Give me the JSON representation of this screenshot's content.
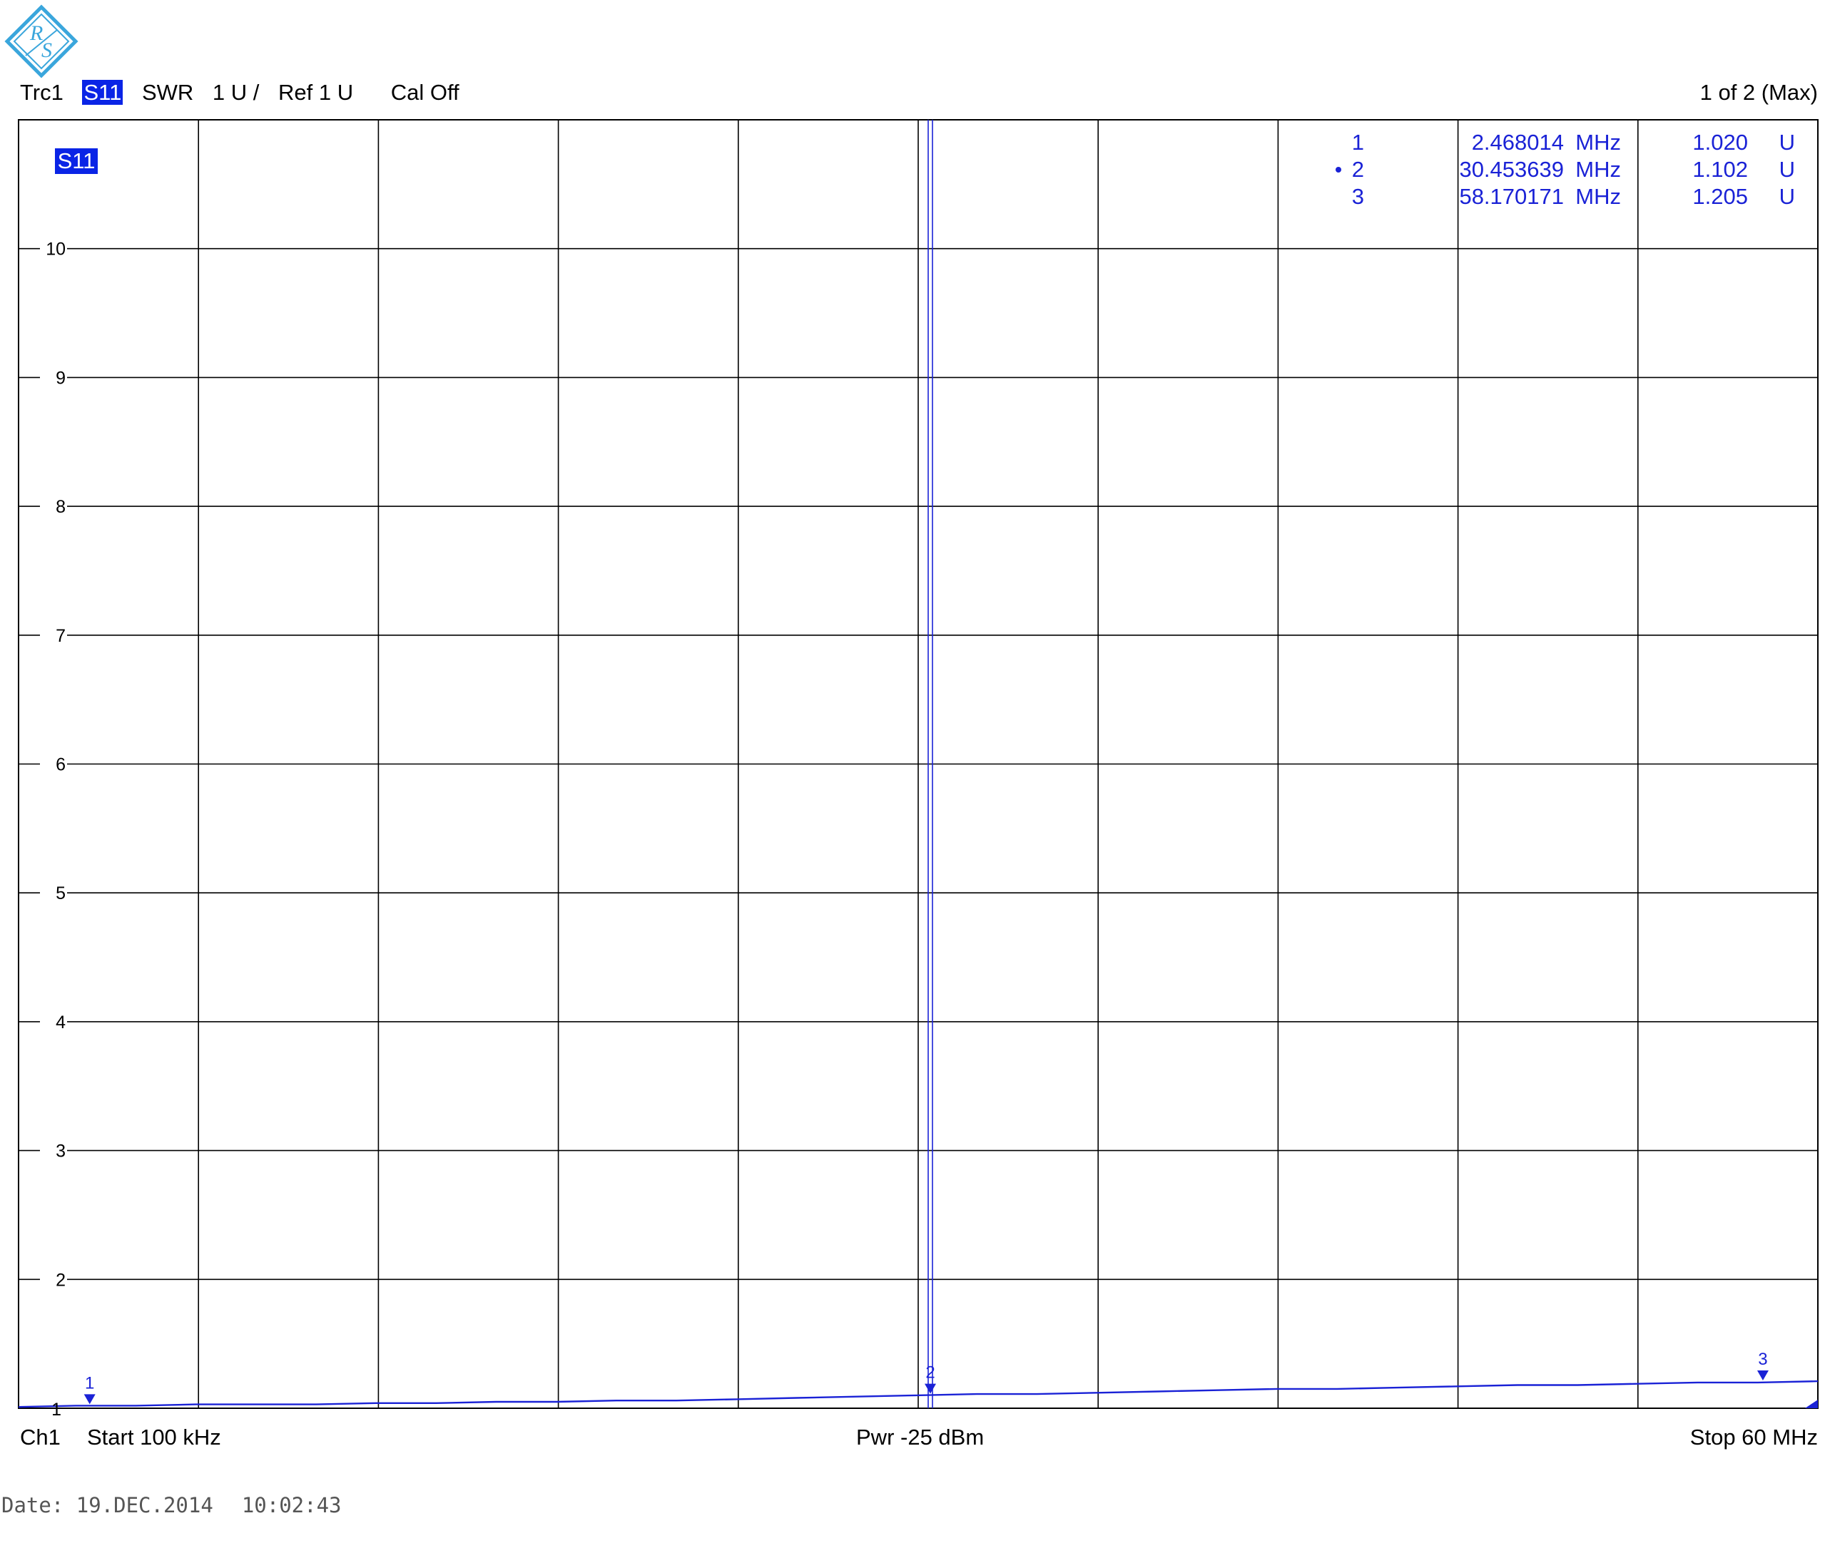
{
  "header": {
    "trace": "Trc1",
    "parameter": "S11",
    "format": "SWR",
    "scale": "1 U /",
    "ref": "Ref 1 U",
    "cal": "Cal Off",
    "page_indicator": "1 of 2 (Max)"
  },
  "trace_badge": "S11",
  "logo_name": "rohde-schwarz-logo",
  "colors": {
    "trace": "#1a22d6",
    "badge_bg": "#0a24e6",
    "logo": "#3aa6dc",
    "grid": "#000000"
  },
  "chart_data": {
    "type": "line",
    "xlabel": "",
    "ylabel": "",
    "xlim": [
      0.1,
      60
    ],
    "ylim": [
      1,
      11
    ],
    "yticks": [
      2,
      3,
      4,
      5,
      6,
      7,
      8,
      9,
      10
    ],
    "ytick_labels": [
      "2",
      "3",
      "4",
      "5",
      "6",
      "7",
      "8",
      "9",
      "10"
    ],
    "bottom_label": "1",
    "grid": true,
    "x_divisions": 10,
    "series": [
      {
        "x": [
          0.1,
          2,
          4,
          6,
          8,
          10,
          12,
          14,
          16,
          18,
          20,
          22,
          24,
          26,
          28,
          30,
          32,
          34,
          36,
          38,
          40,
          42,
          44,
          46,
          48,
          50,
          52,
          54,
          56,
          58,
          60
        ],
        "y": [
          1.01,
          1.02,
          1.02,
          1.03,
          1.03,
          1.03,
          1.04,
          1.04,
          1.05,
          1.05,
          1.06,
          1.06,
          1.07,
          1.08,
          1.09,
          1.1,
          1.11,
          1.11,
          1.12,
          1.13,
          1.14,
          1.15,
          1.15,
          1.16,
          1.17,
          1.18,
          1.18,
          1.19,
          1.2,
          1.2,
          1.21
        ]
      }
    ],
    "markers": [
      {
        "id": "1",
        "freq": "2.468014",
        "freq_unit": "MHz",
        "value": "1.020",
        "value_unit": "U",
        "x": 2.468014,
        "y": 1.02,
        "active": false
      },
      {
        "id": "2",
        "freq": "30.453639",
        "freq_unit": "MHz",
        "value": "1.102",
        "value_unit": "U",
        "x": 30.453639,
        "y": 1.102,
        "active": true
      },
      {
        "id": "3",
        "freq": "58.170171",
        "freq_unit": "MHz",
        "value": "1.205",
        "value_unit": "U",
        "x": 58.170171,
        "y": 1.205,
        "active": false
      }
    ]
  },
  "footer": {
    "channel": "Ch1",
    "start": "Start  100 kHz",
    "power": "Pwr  -25 dBm",
    "stop": "Stop  60 MHz"
  },
  "date": {
    "label": "Date: 19.DEC.2014",
    "time": "10:02:43"
  }
}
